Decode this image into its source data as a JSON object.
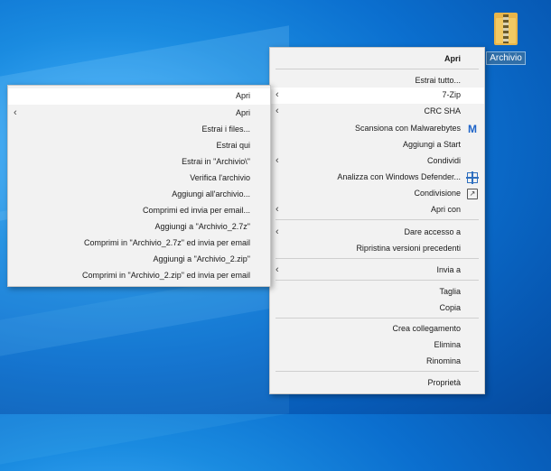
{
  "desktop_icon": {
    "label": "Archivio"
  },
  "main_menu": {
    "items": [
      {
        "label": "Apri",
        "bold": true
      },
      {
        "label": "Estrai tutto..."
      },
      {
        "label": "7-Zip",
        "arrow": true,
        "highlighted": true
      },
      {
        "label": "CRC SHA",
        "arrow": true
      },
      {
        "label": "Scansiona con Malwarebytes",
        "icon": "malwarebytes-icon"
      },
      {
        "label": "Aggiungi a Start"
      },
      {
        "label": "Condividi",
        "arrow": true
      },
      {
        "label": "Analizza con Windows Defender...",
        "icon": "windows-defender-icon"
      },
      {
        "label": "Condivisione",
        "icon": "share-icon"
      },
      {
        "label": "Apri con",
        "arrow": true
      },
      {
        "label": "Dare accesso a",
        "arrow": true
      },
      {
        "label": "Ripristina versioni precedenti"
      },
      {
        "label": "Invia a",
        "arrow": true
      },
      {
        "label": "Taglia"
      },
      {
        "label": "Copia"
      },
      {
        "label": "Crea collegamento"
      },
      {
        "label": "Elimina"
      },
      {
        "label": "Rinomina"
      },
      {
        "label": "Proprietà"
      }
    ]
  },
  "sub_menu": {
    "items": [
      {
        "label": "Apri",
        "highlighted": true
      },
      {
        "label": "Apri",
        "arrow": true
      },
      {
        "label": "Estrai i files..."
      },
      {
        "label": "Estrai qui"
      },
      {
        "label": "Estrai in \"Archivio\\\""
      },
      {
        "label": "Verifica l'archivio"
      },
      {
        "label": "Aggiungi all'archivio..."
      },
      {
        "label": "Comprimi ed invia per email..."
      },
      {
        "label": "Aggiungi a \"Archivio_2.7z\""
      },
      {
        "label": "Comprimi in \"Archivio_2.7z\" ed invia per email"
      },
      {
        "label": "Aggiungi a \"Archivio_2.zip\""
      },
      {
        "label": "Comprimi in \"Archivio_2.zip\" ed invia per email"
      }
    ]
  }
}
